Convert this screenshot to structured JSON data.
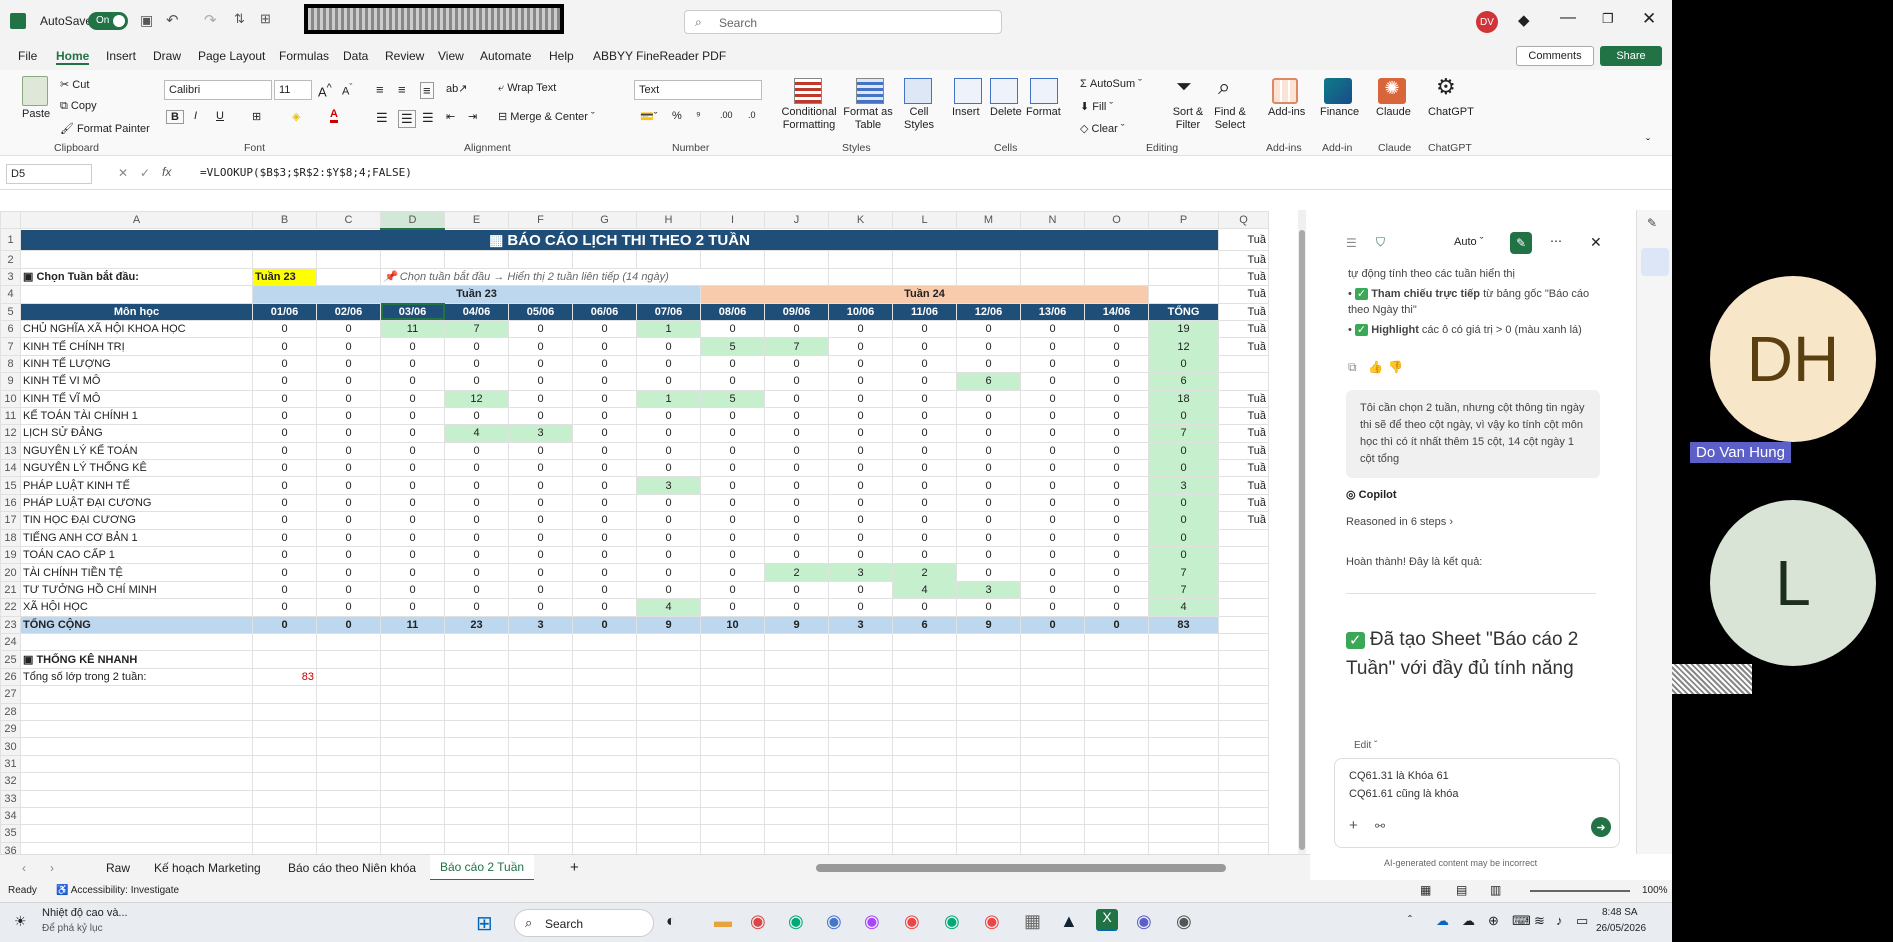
{
  "app": {
    "autosave": "AutoSave",
    "autosave_state": "On",
    "search_placeholder": "Search",
    "user_initials": "DV"
  },
  "menu": [
    "File",
    "Home",
    "Insert",
    "Draw",
    "Page Layout",
    "Formulas",
    "Data",
    "Review",
    "View",
    "Automate",
    "Help",
    "ABBYY FineReader PDF"
  ],
  "menu_buttons": {
    "comments": "Comments",
    "share": "Share"
  },
  "ribbon": {
    "clipboard": {
      "paste": "Paste",
      "cut": "Cut",
      "copy": "Copy",
      "format_painter": "Format Painter",
      "label": "Clipboard"
    },
    "font": {
      "name": "Calibri",
      "size": "11",
      "label": "Font"
    },
    "alignment": {
      "wrap": "Wrap Text",
      "merge": "Merge & Center",
      "label": "Alignment"
    },
    "number": {
      "format": "Text",
      "label": "Number"
    },
    "styles": {
      "cond": "Conditional Formatting",
      "table": "Format as Table",
      "cell": "Cell Styles",
      "label": "Styles"
    },
    "cells": {
      "insert": "Insert",
      "delete": "Delete",
      "format": "Format",
      "label": "Cells"
    },
    "editing": {
      "autosum": "AutoSum",
      "fill": "Fill",
      "clear": "Clear",
      "sort": "Sort & Filter",
      "find": "Find & Select",
      "label": "Editing"
    },
    "addins": {
      "addins": "Add-ins",
      "finance": "Finance",
      "claude": "Claude",
      "chatgpt": "ChatGPT",
      "l1": "Add-ins",
      "l2": "Add-in",
      "l3": "Claude",
      "l4": "ChatGPT"
    }
  },
  "formula": {
    "namebox": "D5",
    "fx": "fx",
    "value": "=VLOOKUP($B$3;$R$2:$Y$8;4;FALSE)"
  },
  "columns": [
    "A",
    "B",
    "C",
    "D",
    "E",
    "F",
    "G",
    "H",
    "I",
    "J",
    "K",
    "L",
    "M",
    "N",
    "O",
    "P",
    "Q"
  ],
  "sheet": {
    "title": "BÁO CÁO LỊCH THI THEO 2 TUẦN",
    "chon_label": "Chọn Tuần bắt đầu:",
    "chon_value": "Tuần 23",
    "hint": "Chọn tuần bắt đầu → Hiển thị 2 tuần liên tiếp (14 ngày)",
    "week1": "Tuần 23",
    "week2": "Tuần 24",
    "header_subject": "Môn học",
    "dates": [
      "01/06",
      "02/06",
      "03/06",
      "04/06",
      "05/06",
      "06/06",
      "07/06",
      "08/06",
      "09/06",
      "10/06",
      "11/06",
      "12/06",
      "13/06",
      "14/06"
    ],
    "total_header": "TỔNG",
    "rows": [
      {
        "name": "CHỦ NGHĨA XÃ HỘI KHOA HỌC",
        "v": [
          0,
          0,
          11,
          7,
          0,
          0,
          1,
          0,
          0,
          0,
          0,
          0,
          0,
          0
        ],
        "t": 19
      },
      {
        "name": "KINH TẾ CHÍNH TRỊ",
        "v": [
          0,
          0,
          0,
          0,
          0,
          0,
          0,
          5,
          7,
          0,
          0,
          0,
          0,
          0
        ],
        "t": 12
      },
      {
        "name": "KINH TẾ LƯỢNG",
        "v": [
          0,
          0,
          0,
          0,
          0,
          0,
          0,
          0,
          0,
          0,
          0,
          0,
          0,
          0
        ],
        "t": 0
      },
      {
        "name": "KINH TẾ VI MÔ",
        "v": [
          0,
          0,
          0,
          0,
          0,
          0,
          0,
          0,
          0,
          0,
          0,
          6,
          0,
          0
        ],
        "t": 6
      },
      {
        "name": "KINH TẾ VĨ MÔ",
        "v": [
          0,
          0,
          0,
          12,
          0,
          0,
          1,
          5,
          0,
          0,
          0,
          0,
          0,
          0
        ],
        "t": 18
      },
      {
        "name": "KẾ TOÁN TÀI CHÍNH 1",
        "v": [
          0,
          0,
          0,
          0,
          0,
          0,
          0,
          0,
          0,
          0,
          0,
          0,
          0,
          0
        ],
        "t": 0
      },
      {
        "name": "LỊCH SỬ ĐẢNG",
        "v": [
          0,
          0,
          0,
          4,
          3,
          0,
          0,
          0,
          0,
          0,
          0,
          0,
          0,
          0
        ],
        "t": 7
      },
      {
        "name": "NGUYÊN LÝ KẾ TOÁN",
        "v": [
          0,
          0,
          0,
          0,
          0,
          0,
          0,
          0,
          0,
          0,
          0,
          0,
          0,
          0
        ],
        "t": 0
      },
      {
        "name": "NGUYÊN LÝ THỐNG KÊ",
        "v": [
          0,
          0,
          0,
          0,
          0,
          0,
          0,
          0,
          0,
          0,
          0,
          0,
          0,
          0
        ],
        "t": 0
      },
      {
        "name": "PHÁP LUẬT KINH TẾ",
        "v": [
          0,
          0,
          0,
          0,
          0,
          0,
          3,
          0,
          0,
          0,
          0,
          0,
          0,
          0
        ],
        "t": 3
      },
      {
        "name": "PHÁP LUẬT ĐẠI CƯƠNG",
        "v": [
          0,
          0,
          0,
          0,
          0,
          0,
          0,
          0,
          0,
          0,
          0,
          0,
          0,
          0
        ],
        "t": 0
      },
      {
        "name": "TIN HỌC ĐẠI CƯƠNG",
        "v": [
          0,
          0,
          0,
          0,
          0,
          0,
          0,
          0,
          0,
          0,
          0,
          0,
          0,
          0
        ],
        "t": 0
      },
      {
        "name": "TIẾNG ANH CƠ BẢN 1",
        "v": [
          0,
          0,
          0,
          0,
          0,
          0,
          0,
          0,
          0,
          0,
          0,
          0,
          0,
          0
        ],
        "t": 0
      },
      {
        "name": "TOÁN CAO CẤP 1",
        "v": [
          0,
          0,
          0,
          0,
          0,
          0,
          0,
          0,
          0,
          0,
          0,
          0,
          0,
          0
        ],
        "t": 0
      },
      {
        "name": "TÀI CHÍNH TIỀN TỆ",
        "v": [
          0,
          0,
          0,
          0,
          0,
          0,
          0,
          0,
          2,
          3,
          2,
          0,
          0,
          0
        ],
        "t": 7
      },
      {
        "name": "TƯ TƯỞNG HỒ CHÍ MINH",
        "v": [
          0,
          0,
          0,
          0,
          0,
          0,
          0,
          0,
          0,
          0,
          4,
          3,
          0,
          0
        ],
        "t": 7
      },
      {
        "name": "XÃ HỘI HỌC",
        "v": [
          0,
          0,
          0,
          0,
          0,
          0,
          4,
          0,
          0,
          0,
          0,
          0,
          0,
          0
        ],
        "t": 4
      }
    ],
    "total_row": {
      "name": "TỔNG CỘNG",
      "v": [
        0,
        0,
        11,
        23,
        3,
        0,
        9,
        10,
        9,
        3,
        6,
        9,
        0,
        0
      ],
      "t": 83
    },
    "stats_title": "THỐNG KÊ NHANH",
    "stats_label": "Tổng số lớp trong 2 tuần:",
    "stats_value": "83",
    "q_cells": [
      "Tuầ",
      "Tuầ",
      "Tuầ",
      "Tuầ",
      "Tuầ",
      "Tuầ",
      "Tuầ"
    ],
    "q_cells2": [
      "Tuầ",
      "Tuầ",
      "Tuầ",
      "Tuầ",
      "Tuầ",
      "Tuầ",
      "Tuầ",
      "Tuầ"
    ]
  },
  "sheet_tabs": [
    "Raw",
    "Kế hoạch Marketing",
    "Báo cáo theo Niên khóa",
    "Báo cáo 2 Tuần"
  ],
  "status": {
    "ready": "Ready",
    "accessibility": "Accessibility: Investigate",
    "zoom": "100%"
  },
  "copilot": {
    "mode": "Auto",
    "line0": "tự động tính theo các tuần hiển thị",
    "bullet1_bold": "Tham chiếu trực tiếp",
    "bullet1": " từ bảng gốc \"Báo cáo theo Ngày thi\"",
    "bullet2_bold": "Highlight",
    "bullet2": " các ô có giá trị > 0 (màu xanh lá)",
    "user_msg": "Tôi cần chọn 2 tuần, nhưng cột thông tin ngày thi sẽ để theo cột ngày, vì vậy ko tính cột môn học thì có ít nhất thêm 15 cột, 14 cột ngày 1 cột tổng",
    "copilot_label": "Copilot",
    "reasoned": "Reasoned in 6 steps",
    "done": "Hoàn thành! Đây là kết quả:",
    "headline": "Đã tạo Sheet \"Báo cáo 2 Tuần\" với đầy đủ tính năng",
    "edit": "Edit",
    "input_line1": "CQ61.31 là Khóa 61",
    "input_line2": "CQ61.61 cũng là khóa",
    "disclaimer": "AI-generated content may be incorrect"
  },
  "participants": [
    {
      "initials": "DH",
      "name": "Do  Van Hung"
    },
    {
      "initials": "L"
    }
  ],
  "taskbar": {
    "weather": "Nhiệt độ cao và...",
    "weather2": "Để phá kỷ lục",
    "search": "Search",
    "time": "8:48 SA",
    "date": "26/05/2026"
  }
}
